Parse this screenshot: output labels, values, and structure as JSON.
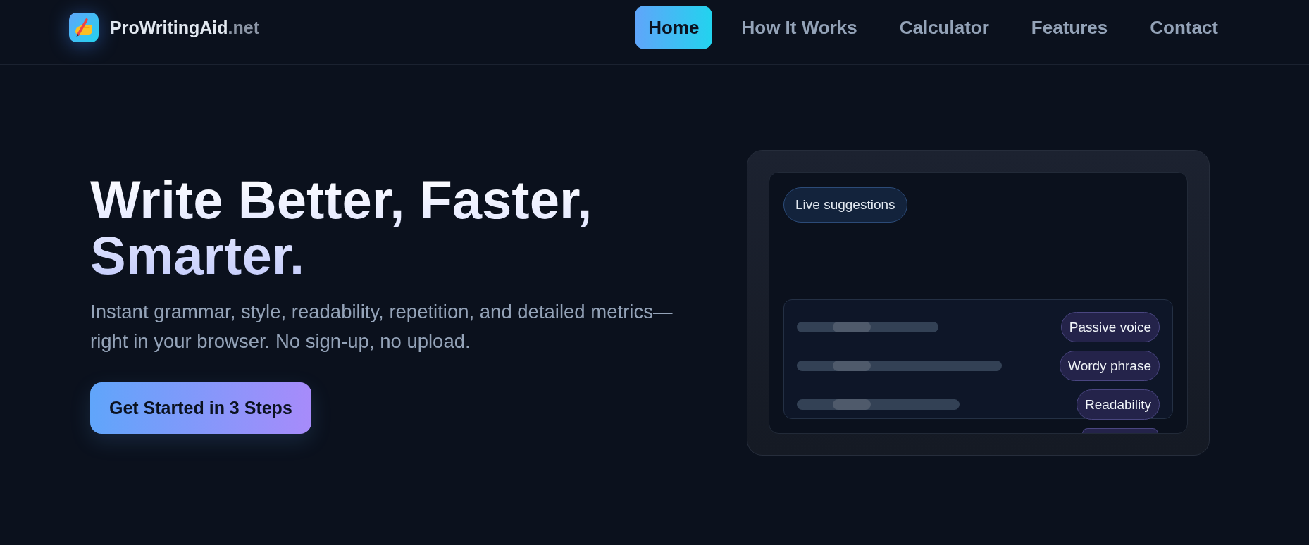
{
  "header": {
    "logo": {
      "name": "ProWritingAid",
      "suffix": ".net"
    },
    "nav": [
      {
        "label": "Home",
        "selected": true
      },
      {
        "label": "How It Works",
        "selected": false
      },
      {
        "label": "Calculator",
        "selected": false
      },
      {
        "label": "Features",
        "selected": false
      },
      {
        "label": "Contact",
        "selected": false
      }
    ]
  },
  "hero": {
    "title": "Write Better, Faster, Smarter.",
    "subtitle": "Instant grammar, style, readability, repetition, and detailed metrics—right in your browser. No sign-up, no upload.",
    "cta": "Get Started in 3 Steps"
  },
  "preview": {
    "badge": "Live suggestions",
    "rows": [
      {
        "kind": "suggestion",
        "label": "Passive voice"
      },
      {
        "kind": "suggestion",
        "label": "Wordy phrase"
      },
      {
        "kind": "suggestion",
        "label": "Readability"
      },
      {
        "kind": "cut_off"
      }
    ]
  }
}
